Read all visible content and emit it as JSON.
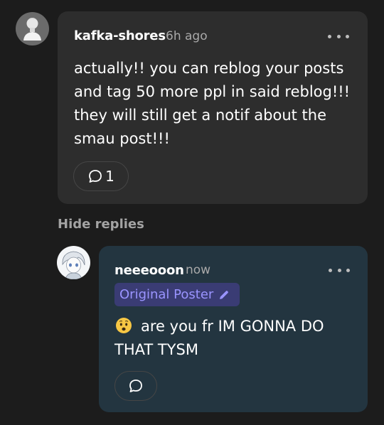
{
  "comment": {
    "username": "kafka-shores",
    "timestamp": "6h ago",
    "text_lines": [
      "actually!! you can reblog your posts",
      "and tag 50 more ppl in said reblog!!!",
      "they will still get a notif about the",
      "smau post!!!"
    ],
    "reply_count": "1",
    "avatar_icon": "statue-bust-icon"
  },
  "thread": {
    "hide_replies_label": "Hide replies"
  },
  "reply": {
    "username": "neeeooon",
    "timestamp": "now",
    "badge_label": "Original Poster",
    "badge_icon": "pencil-icon",
    "emoji": "worried-face",
    "text_lines": [
      "are you fr IM GONNA DO",
      "THAT TYSM"
    ],
    "avatar_icon": "anime-avatar-icon"
  },
  "colors": {
    "background": "#1c1c1c",
    "comment_card": "#2d2d2d",
    "reply_card": "#233540",
    "badge_bg": "#3a3c74",
    "badge_text": "#9a94ff"
  }
}
